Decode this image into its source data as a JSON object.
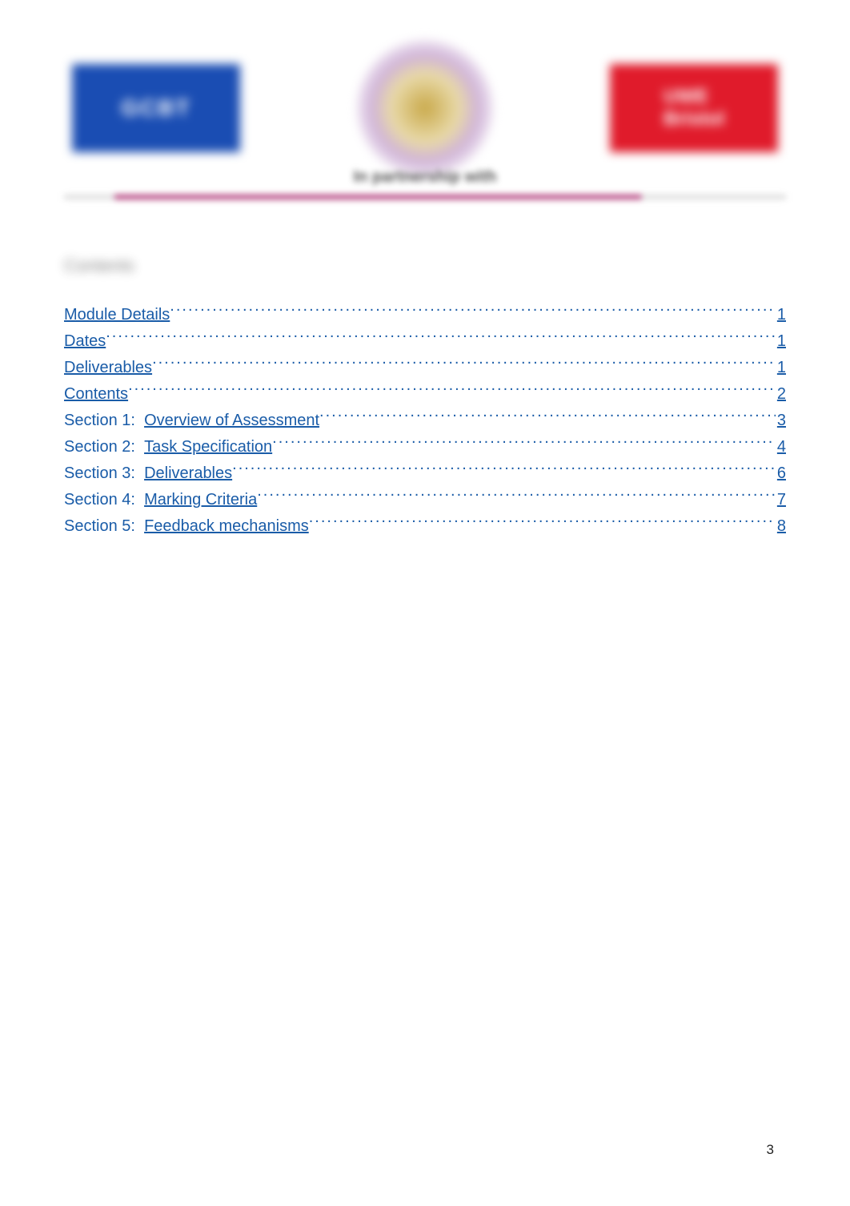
{
  "header": {
    "logo_left_line1": "GCBT",
    "logo_left_line2": "",
    "logo_right_line1": "UWE",
    "logo_right_line2": "Bristol",
    "partnership_caption": "In partnership with"
  },
  "heading": "Contents",
  "toc": [
    {
      "prefix": "",
      "title": "Module Details",
      "page": "1"
    },
    {
      "prefix": "",
      "title": "Dates",
      "page": "1"
    },
    {
      "prefix": "",
      "title": "Deliverables",
      "page": "1"
    },
    {
      "prefix": "",
      "title": "Contents",
      "page": "2"
    },
    {
      "prefix": "Section 1:",
      "title": "Overview of Assessment",
      "page": "3"
    },
    {
      "prefix": "Section 2:",
      "title": "Task Specification",
      "page": "4"
    },
    {
      "prefix": "Section 3:",
      "title": "Deliverables",
      "page": "6"
    },
    {
      "prefix": "Section 4:",
      "title": "Marking Criteria",
      "page": "7"
    },
    {
      "prefix": "Section 5:",
      "title": "Feedback mechanisms",
      "page": "8"
    }
  ],
  "page_number": "3",
  "colors": {
    "link": "#1a5ca8",
    "logo_blue": "#1a4db3",
    "logo_red": "#e01b2b",
    "divider": "#b23c7a"
  }
}
